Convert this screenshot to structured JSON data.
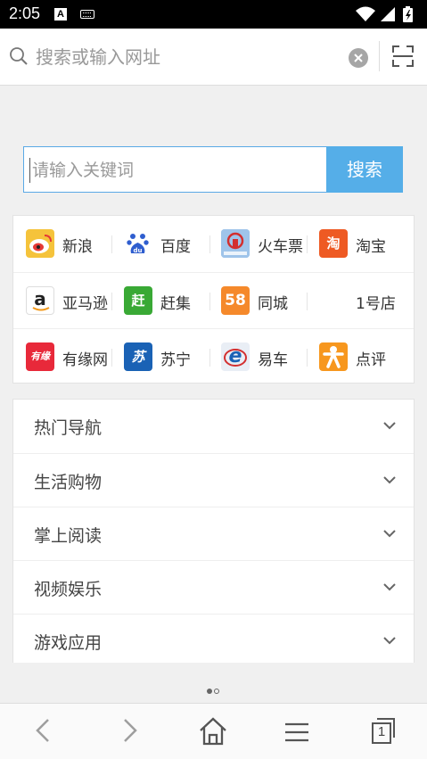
{
  "status_bar": {
    "time": "2:05",
    "icons": [
      "a-notification-icon",
      "keyboard-icon",
      "wifi-icon",
      "cell-signal-icon",
      "battery-charging-icon"
    ]
  },
  "url_bar": {
    "placeholder": "搜索或输入网址",
    "value": "",
    "icons": [
      "search-icon",
      "clear-icon",
      "scan-icon"
    ]
  },
  "search": {
    "placeholder": "请输入关键词",
    "button_label": "搜索",
    "accent": "#55aee8"
  },
  "quick_links": [
    [
      {
        "label": "新浪",
        "icon": "sina-weibo-icon",
        "color": "#f5c33b"
      },
      {
        "label": "百度",
        "icon": "baidu-paw-icon",
        "color": "#2f5ecf"
      },
      {
        "label": "火车票",
        "icon": "train-ticket-icon",
        "color": "#7fb0e0"
      },
      {
        "label": "淘宝",
        "icon": "taobao-icon",
        "color": "#ee5a23",
        "glyph": "淘"
      }
    ],
    [
      {
        "label": "亚马逊",
        "icon": "amazon-icon",
        "color": "#ffffff",
        "glyph": "a"
      },
      {
        "label": "赶集",
        "icon": "ganji-icon",
        "color": "#39a935",
        "glyph": "赶"
      },
      {
        "label": "同城",
        "icon": "58-tongcheng-icon",
        "color": "#f5892b",
        "glyph": "58"
      },
      {
        "label": "1号店",
        "icon": "",
        "color": ""
      }
    ],
    [
      {
        "label": "有缘网",
        "icon": "youyuan-icon",
        "color": "#e8293a",
        "glyph": "有缘"
      },
      {
        "label": "苏宁",
        "icon": "suning-icon",
        "color": "#1a62b5",
        "glyph": "苏"
      },
      {
        "label": "易车",
        "icon": "yiche-icon",
        "color": "#e9eef5",
        "glyph": "e"
      },
      {
        "label": "点评",
        "icon": "dianping-icon",
        "color": "#f7971e"
      }
    ]
  ],
  "categories": [
    {
      "label": "热门导航"
    },
    {
      "label": "生活购物"
    },
    {
      "label": "掌上阅读"
    },
    {
      "label": "视频娱乐"
    },
    {
      "label": "游戏应用"
    }
  ],
  "pager": {
    "count": 2,
    "active_index": 0
  },
  "bottom_bar": {
    "tab_count": "1",
    "icons": [
      "back-icon",
      "forward-icon",
      "home-icon",
      "menu-icon",
      "tabs-icon"
    ]
  }
}
